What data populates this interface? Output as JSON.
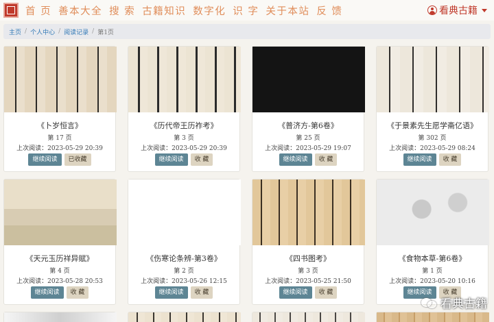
{
  "nav": {
    "items": [
      "首 页",
      "善本大全",
      "搜 索",
      "古籍知识",
      "数字化",
      "识 字",
      "关于本站",
      "反 馈"
    ],
    "user_label": "看典古籍"
  },
  "breadcrumb": {
    "items": [
      "主页",
      "个人中心",
      "阅读记录"
    ],
    "current": "第1页"
  },
  "cards": [
    {
      "title": "《卜岁恒言》",
      "page": "第 17 页",
      "last_read": "上次阅读：2023-05-29 20:39",
      "read_btn": "继续阅读",
      "fav_btn": "已收藏"
    },
    {
      "title": "《历代帝王历祚考》",
      "page": "第 3 页",
      "last_read": "上次阅读：2023-05-29 20:39",
      "read_btn": "继续阅读",
      "fav_btn": "收 藏"
    },
    {
      "title": "《普济方-第6卷》",
      "page": "第 25 页",
      "last_read": "上次阅读：2023-05-29 19:07",
      "read_btn": "继续阅读",
      "fav_btn": "收 藏"
    },
    {
      "title": "《于景素先生愿学斋亿语》",
      "page": "第 302 页",
      "last_read": "上次阅读：2023-05-29 08:24",
      "read_btn": "继续阅读",
      "fav_btn": "收 藏"
    },
    {
      "title": "《天元玉历祥异赋》",
      "page": "第 4 页",
      "last_read": "上次阅读：2023-05-28 20:53",
      "read_btn": "继续阅读",
      "fav_btn": "收 藏"
    },
    {
      "title": "《伤寒论条辨-第3卷》",
      "page": "第 2 页",
      "last_read": "上次阅读：2023-05-26 12:15",
      "read_btn": "继续阅读",
      "fav_btn": "收 藏"
    },
    {
      "title": "《四书图考》",
      "page": "第 3 页",
      "last_read": "上次阅读：2023-05-25 21:50",
      "read_btn": "继续阅读",
      "fav_btn": "收 藏"
    },
    {
      "title": "《食物本草-第6卷》",
      "page": "第 1 页",
      "last_read": "上次阅读：2023-05-20 10:16",
      "read_btn": "继续阅读",
      "fav_btn": "收 藏"
    }
  ],
  "watermark": "看典古籍",
  "colors": {
    "nav_text": "#e08d5a",
    "brand_red": "#c0392b",
    "read_button": "#5d8594",
    "fav_button": "#ddd4c1"
  }
}
